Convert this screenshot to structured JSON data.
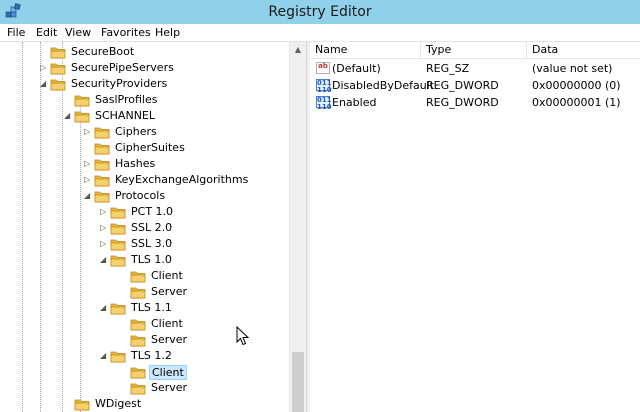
{
  "window": {
    "title": "Registry Editor"
  },
  "menu": {
    "items": [
      "File",
      "Edit",
      "View",
      "Favorites",
      "Help"
    ]
  },
  "tree": {
    "nodes": [
      {
        "label": "SecureBoot",
        "expander": "",
        "selected": false
      },
      {
        "label": "SecurePipeServers",
        "expander": "collapsed",
        "selected": false
      },
      {
        "label": "SecurityProviders",
        "expander": "expanded",
        "selected": false
      },
      {
        "label": "SaslProfiles",
        "expander": "",
        "selected": false
      },
      {
        "label": "SCHANNEL",
        "expander": "expanded",
        "selected": false
      },
      {
        "label": "Ciphers",
        "expander": "collapsed",
        "selected": false
      },
      {
        "label": "CipherSuites",
        "expander": "",
        "selected": false
      },
      {
        "label": "Hashes",
        "expander": "collapsed",
        "selected": false
      },
      {
        "label": "KeyExchangeAlgorithms",
        "expander": "collapsed",
        "selected": false
      },
      {
        "label": "Protocols",
        "expander": "expanded",
        "selected": false
      },
      {
        "label": "PCT 1.0",
        "expander": "collapsed",
        "selected": false
      },
      {
        "label": "SSL 2.0",
        "expander": "collapsed",
        "selected": false
      },
      {
        "label": "SSL 3.0",
        "expander": "collapsed",
        "selected": false
      },
      {
        "label": "TLS 1.0",
        "expander": "expanded",
        "selected": false
      },
      {
        "label": "Client",
        "expander": "",
        "selected": false
      },
      {
        "label": "Server",
        "expander": "",
        "selected": false
      },
      {
        "label": "TLS 1.1",
        "expander": "expanded",
        "selected": false
      },
      {
        "label": "Client",
        "expander": "",
        "selected": false
      },
      {
        "label": "Server",
        "expander": "",
        "selected": false
      },
      {
        "label": "TLS 1.2",
        "expander": "expanded",
        "selected": false
      },
      {
        "label": "Client",
        "expander": "",
        "selected": true
      },
      {
        "label": "Server",
        "expander": "",
        "selected": false
      },
      {
        "label": "WDigest",
        "expander": "",
        "selected": false
      }
    ]
  },
  "list": {
    "columns": {
      "name": "Name",
      "type": "Type",
      "data": "Data"
    },
    "rows": [
      {
        "icon": "string-value-icon",
        "icon_text": "ab",
        "name": "(Default)",
        "type": "REG_SZ",
        "data": "(value not set)"
      },
      {
        "icon": "dword-value-icon",
        "icon_text": "011\n110",
        "name": "DisabledByDefault",
        "type": "REG_DWORD",
        "data": "0x00000000 (0)"
      },
      {
        "icon": "dword-value-icon",
        "icon_text": "011\n110",
        "name": "Enabled",
        "type": "REG_DWORD",
        "data": "0x00000001 (1)"
      }
    ]
  },
  "colors": {
    "titlebar": "#8fd0ea",
    "selection": "#cce8ff",
    "folder": "#e8b93b"
  }
}
